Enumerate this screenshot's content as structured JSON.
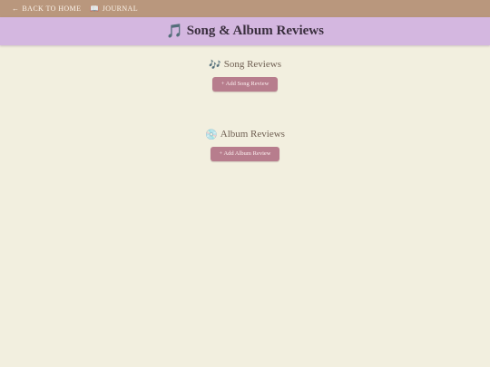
{
  "nav": {
    "back": {
      "icon": "←",
      "label": "Back to Home"
    },
    "journal": {
      "icon": "📖",
      "label": "Journal"
    }
  },
  "header": {
    "icon": "🎵",
    "title": "Song & Album Reviews"
  },
  "songs": {
    "icon": "🎶",
    "title": "Song Reviews",
    "button_label": "+ Add Song Review"
  },
  "albums": {
    "icon": "💿",
    "title": "Album Reviews",
    "button_label": "+ Add Album Review"
  },
  "colors": {
    "background": "#f2efdf",
    "nav_bar": "#b9977d",
    "title_bar": "#d4b7e0",
    "button": "#b77d8d"
  }
}
